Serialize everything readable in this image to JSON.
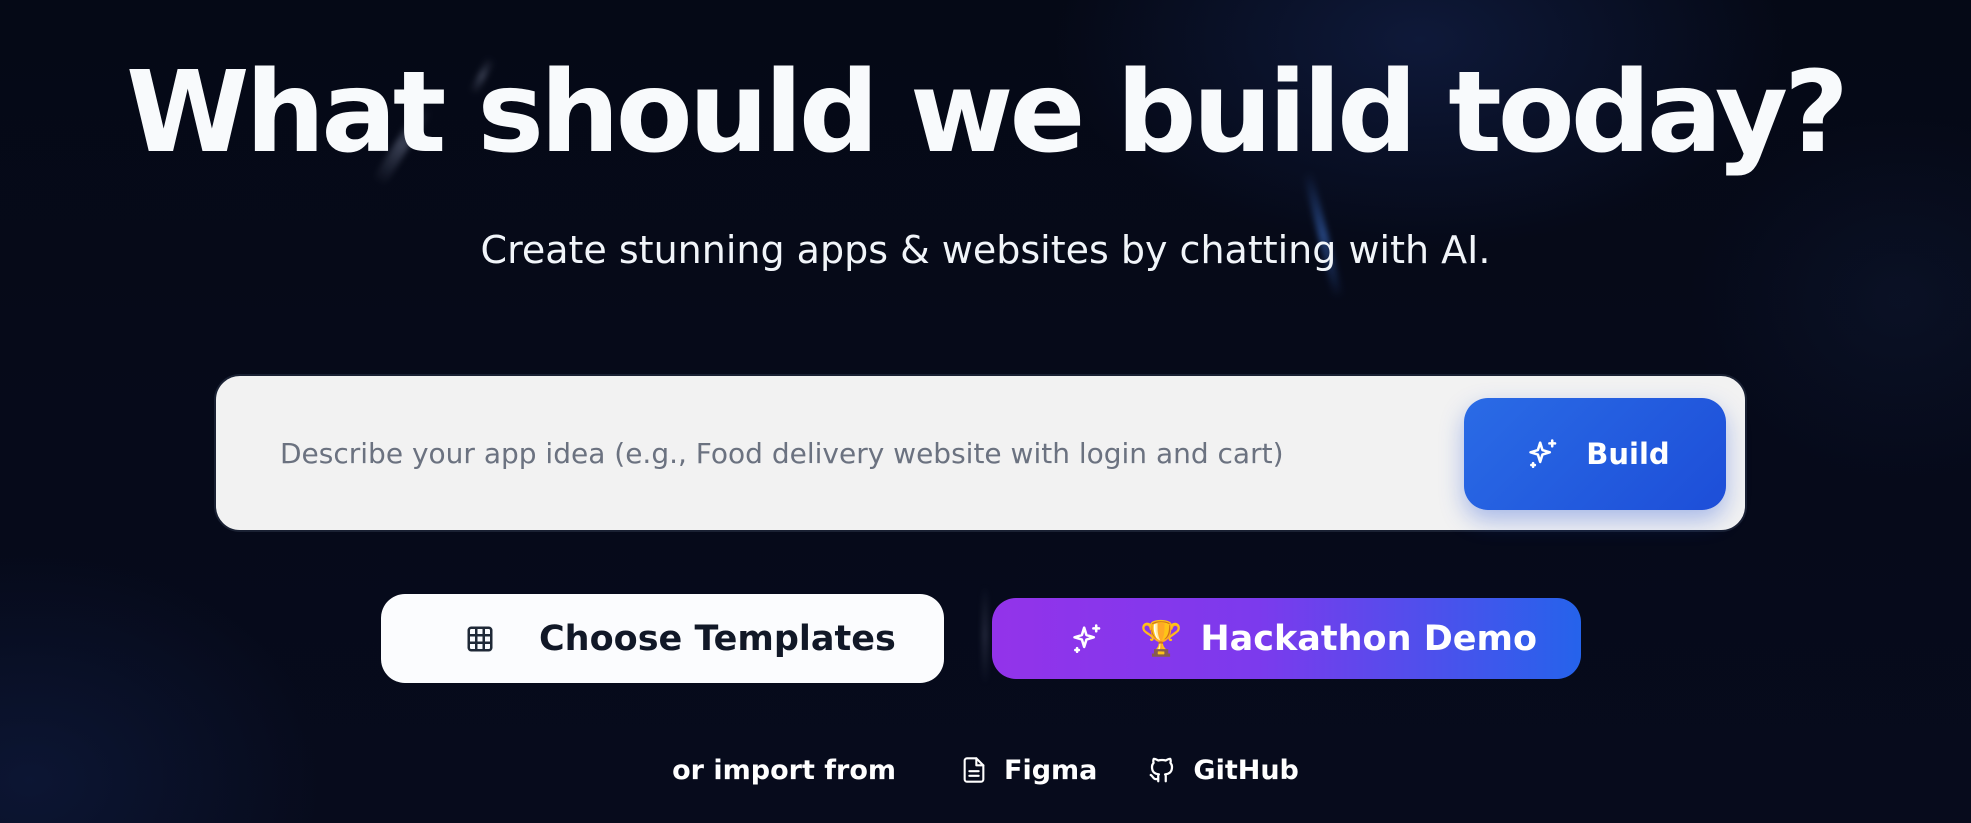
{
  "hero": {
    "title": "What should we build today?",
    "subtitle": "Create stunning apps & websites by chatting with AI."
  },
  "prompt": {
    "placeholder": "Describe your app idea (e.g., Food delivery website with login and cart)",
    "value": "",
    "build_label": "Build",
    "build_icon": "sparkles-icon"
  },
  "actions": {
    "templates_label": "Choose Templates",
    "templates_icon": "grid-icon",
    "hackathon_label": "Hackathon Demo",
    "hackathon_emoji": "🏆",
    "hackathon_icon": "sparkles-icon"
  },
  "import": {
    "label": "or import from",
    "figma_label": "Figma",
    "figma_icon": "file-icon",
    "github_label": "GitHub",
    "github_icon": "github-icon"
  },
  "colors": {
    "background": "#050916",
    "accent_blue": "#1d4ed8",
    "accent_purple": "#9333ea",
    "input_background": "#f2f2f2"
  }
}
